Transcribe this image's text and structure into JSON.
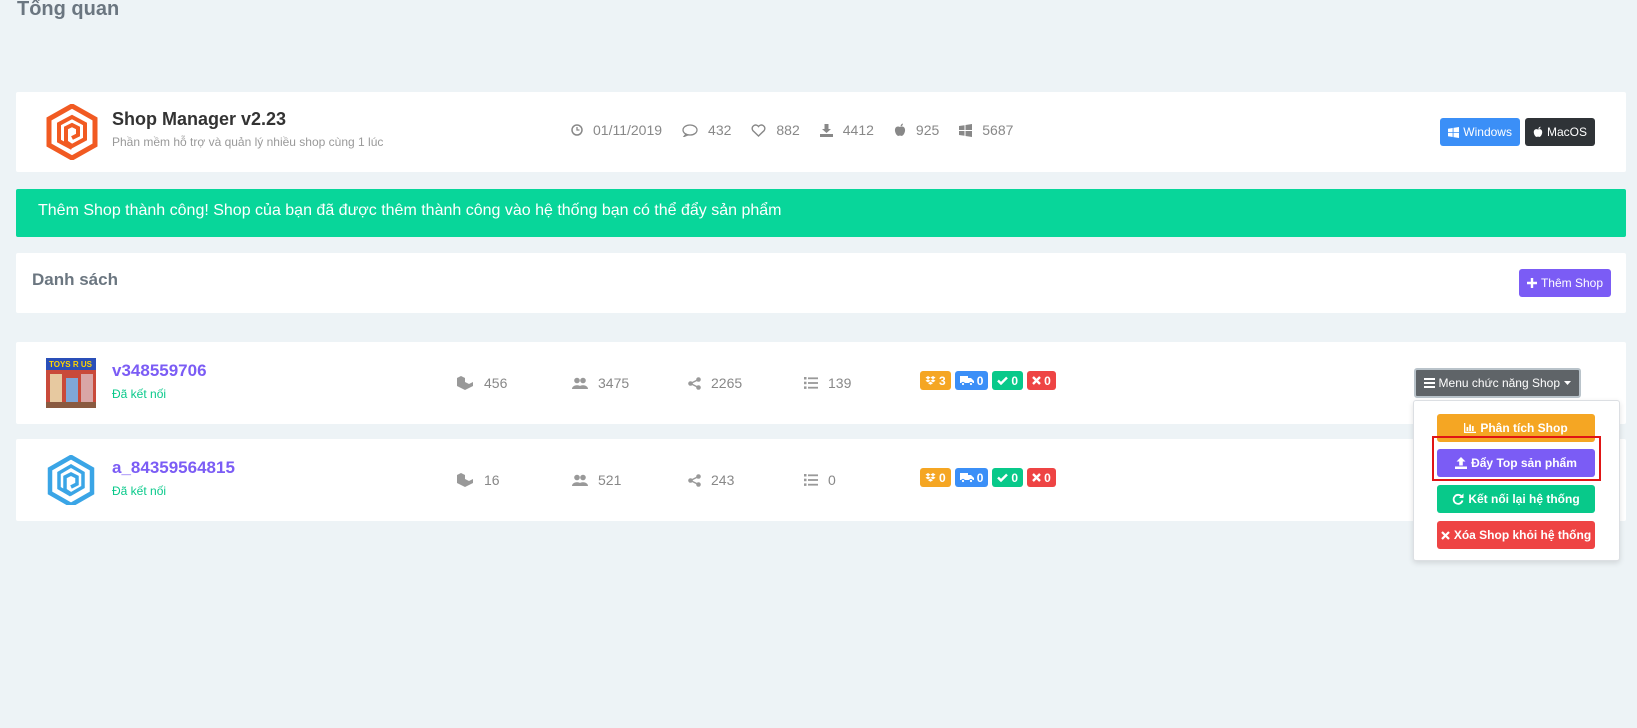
{
  "page": {
    "title": "Tổng quan"
  },
  "app": {
    "name": "Shop Manager v2.23",
    "description": "Phần mềm hỗ trợ và quản lý nhiều shop cùng 1 lúc",
    "stats": {
      "date": "01/11/2019",
      "comments": "432",
      "likes": "882",
      "downloads": "4412",
      "mac": "925",
      "windows": "5687"
    },
    "buttons": {
      "windows": "Windows",
      "macos": "MacOS"
    },
    "colors": {
      "logo": "#f15a22"
    }
  },
  "alert": {
    "message": "Thêm Shop thành công! Shop của bạn đã được thêm thành công vào hệ thống bạn có thể đẩy sản phẩm"
  },
  "list": {
    "title": "Danh sách",
    "add_button": "Thêm Shop"
  },
  "shops": [
    {
      "name": "v348559706",
      "status": "Đã kết nối",
      "products": "456",
      "followers": "3475",
      "shares": "2265",
      "items": "139",
      "badges": {
        "boxes": "3",
        "shipping": "0",
        "done": "0",
        "cancelled": "0"
      }
    },
    {
      "name": "a_84359564815",
      "status": "Đã kết nối",
      "products": "16",
      "followers": "521",
      "shares": "243",
      "items": "0",
      "badges": {
        "boxes": "0",
        "shipping": "0",
        "done": "0",
        "cancelled": "0"
      }
    }
  ],
  "menu": {
    "toggle": "Menu chức năng Shop",
    "items": [
      "Phân tích Shop",
      "Đẩy Top sản phẩm",
      "Kết nối lại hệ thống",
      "Xóa Shop khỏi hệ thống"
    ]
  },
  "colors": {
    "accent": "#7b5cf5",
    "success": "#08d69a",
    "warning": "#f5a623",
    "danger": "#ee4444",
    "info": "#3b8ff7"
  }
}
